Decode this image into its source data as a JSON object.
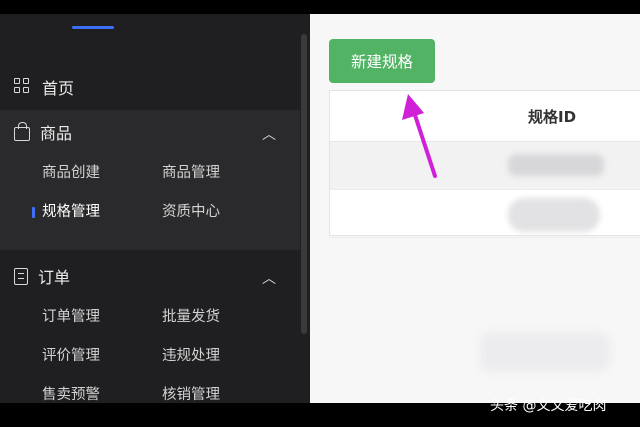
{
  "sidebar": {
    "home_label": "首页",
    "goods": {
      "title": "商品",
      "items": [
        {
          "label": "商品创建"
        },
        {
          "label": "商品管理"
        },
        {
          "label": "规格管理",
          "active": true
        },
        {
          "label": "资质中心"
        }
      ]
    },
    "orders": {
      "title": "订单",
      "items": [
        {
          "label": "订单管理"
        },
        {
          "label": "批量发货"
        },
        {
          "label": "评价管理"
        },
        {
          "label": "违规处理"
        },
        {
          "label": "售卖预警"
        },
        {
          "label": "核销管理"
        }
      ]
    }
  },
  "main": {
    "new_button_label": "新建规格",
    "table_header": "规格ID"
  },
  "credit": "头条 @文文爱吃肉",
  "colors": {
    "accent_green": "#52b365",
    "sidebar_bg": "#1f1f21",
    "active_indicator": "#3b6ff5",
    "annotation_arrow": "#d020d8"
  }
}
